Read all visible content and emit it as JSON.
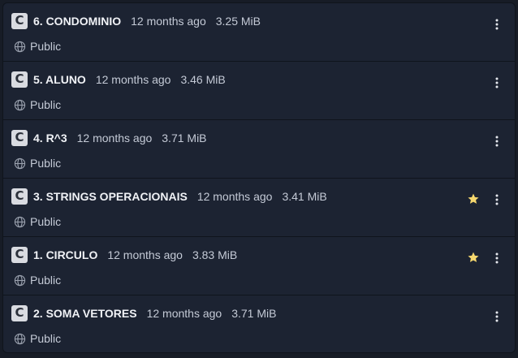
{
  "items": [
    {
      "title": "6. CONDOMINIO",
      "updated": "12 months ago",
      "size": "3.25 MiB",
      "visibility": "Public",
      "starred": false
    },
    {
      "title": "5. ALUNO",
      "updated": "12 months ago",
      "size": "3.46 MiB",
      "visibility": "Public",
      "starred": false
    },
    {
      "title": "4. R^3",
      "updated": "12 months ago",
      "size": "3.71 MiB",
      "visibility": "Public",
      "starred": false
    },
    {
      "title": "3. STRINGS OPERACIONAIS",
      "updated": "12 months ago",
      "size": "3.41 MiB",
      "visibility": "Public",
      "starred": true
    },
    {
      "title": "1. CIRCULO",
      "updated": "12 months ago",
      "size": "3.83 MiB",
      "visibility": "Public",
      "starred": true
    },
    {
      "title": "2. SOMA VETORES",
      "updated": "12 months ago",
      "size": "3.71 MiB",
      "visibility": "Public",
      "starred": false
    }
  ],
  "logo_letter": "C",
  "icons": {
    "logo": "c-language-icon",
    "visibility": "globe-icon",
    "star": "star-icon",
    "menu": "kebab-menu-icon"
  },
  "colors": {
    "background": "#1c2332",
    "title": "#f0f2f6",
    "meta": "#c4cad6",
    "star": "#f5d76e"
  }
}
